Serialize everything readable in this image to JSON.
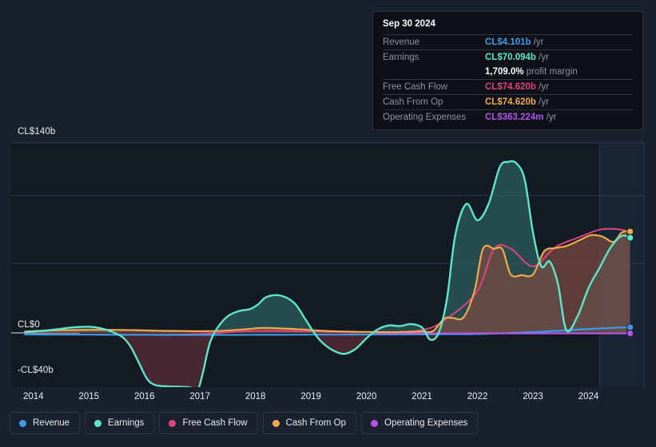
{
  "chart_data": {
    "type": "area",
    "title": "",
    "xlabel": "",
    "ylabel": "",
    "currency_prefix": "CL$",
    "ylim": [
      -40,
      140
    ],
    "yticks": [
      140,
      0,
      -40
    ],
    "ytick_labels": [
      "CL$140b",
      "CL$0",
      "-CL$40b"
    ],
    "grid": true,
    "legend_position": "bottom",
    "x_range": [
      "2013.6",
      "2025.0"
    ],
    "xticks": [
      2014,
      2015,
      2016,
      2017,
      2018,
      2019,
      2020,
      2021,
      2022,
      2023,
      2024
    ],
    "xtick_labels": [
      "2014",
      "2015",
      "2016",
      "2017",
      "2018",
      "2019",
      "2020",
      "2021",
      "2022",
      "2023",
      "2024"
    ],
    "forecast_start": "2024.2",
    "units": "CL$ billions",
    "series": [
      {
        "name": "Revenue",
        "color": "#3d9ae8",
        "x": [
          2013.85,
          2014.5,
          2015.0,
          2015.5,
          2016.0,
          2016.5,
          2017.0,
          2017.5,
          2018.0,
          2018.5,
          2019.0,
          2019.5,
          2020.0,
          2020.5,
          2021.0,
          2021.5,
          2022.0,
          2022.5,
          2023.0,
          2023.3,
          2023.6,
          2024.0,
          2024.4,
          2024.75
        ],
        "values": [
          -1.2,
          -1.3,
          -1.3,
          -1.4,
          -1.4,
          -1.5,
          -1.5,
          -1.5,
          -1.4,
          -1.4,
          -1.3,
          -1.3,
          -1.2,
          -1.2,
          -1.1,
          -1.0,
          -0.8,
          -0.2,
          0.6,
          1.2,
          1.9,
          2.8,
          3.6,
          4.101
        ]
      },
      {
        "name": "Earnings",
        "color": "#5ae8c8",
        "x": [
          2013.85,
          2014.1,
          2014.4,
          2014.7,
          2015.0,
          2015.2,
          2015.4,
          2015.6,
          2015.75,
          2015.9,
          2016.05,
          2016.2,
          2016.45,
          2016.7,
          2016.85,
          2016.95,
          2017.05,
          2017.2,
          2017.45,
          2017.7,
          2017.9,
          2018.05,
          2018.2,
          2018.45,
          2018.7,
          2018.9,
          2019.05,
          2019.2,
          2019.4,
          2019.6,
          2019.8,
          2020.0,
          2020.2,
          2020.4,
          2020.6,
          2020.8,
          2021.0,
          2021.15,
          2021.3,
          2021.45,
          2021.6,
          2021.8,
          2022.0,
          2022.2,
          2022.4,
          2022.55,
          2022.7,
          2022.85,
          2023.0,
          2023.15,
          2023.3,
          2023.45,
          2023.6,
          2023.8,
          2024.0,
          2024.2,
          2024.4,
          2024.6,
          2024.75
        ],
        "values": [
          0.5,
          1.2,
          2.5,
          4.0,
          4.5,
          3.5,
          1.0,
          -3.0,
          -10.0,
          -22.0,
          -34.0,
          -38.5,
          -39.5,
          -39.8,
          -40.5,
          -43.5,
          -30.0,
          -5.0,
          10.5,
          16.0,
          17.5,
          21.0,
          26.5,
          27.5,
          22.0,
          10.0,
          0.5,
          -7.0,
          -13.0,
          -15.5,
          -12.0,
          -4.0,
          2.5,
          5.5,
          5.0,
          6.5,
          4.0,
          -5.0,
          0.0,
          25.0,
          72.0,
          95.0,
          83.0,
          95.0,
          122.0,
          126.0,
          125.0,
          113.0,
          74.0,
          49.0,
          52.5,
          36.0,
          2.0,
          12.0,
          33.0,
          48.0,
          63.0,
          71.5,
          70.094
        ]
      },
      {
        "name": "Free Cash Flow",
        "color": "#e0447f",
        "x": [
          2013.85,
          2015.0,
          2016.0,
          2017.0,
          2018.0,
          2019.0,
          2020.0,
          2021.0,
          2021.5,
          2022.0,
          2022.3,
          2022.6,
          2023.0,
          2023.4,
          2023.8,
          2024.2,
          2024.5,
          2024.75
        ],
        "values": [
          -1.0,
          -1.2,
          -1.5,
          -0.8,
          1.5,
          1.0,
          0.5,
          2.0,
          12.0,
          31.0,
          62.0,
          62.0,
          49.0,
          63.0,
          70.0,
          76.0,
          76.5,
          74.62
        ]
      },
      {
        "name": "Cash From Op",
        "color": "#eeaa4c",
        "x": [
          2013.85,
          2014.2,
          2014.6,
          2015.0,
          2015.4,
          2015.8,
          2016.2,
          2016.6,
          2017.0,
          2017.4,
          2017.8,
          2018.1,
          2018.4,
          2018.8,
          2019.1,
          2019.4,
          2019.8,
          2020.2,
          2020.6,
          2021.0,
          2021.2,
          2021.4,
          2021.55,
          2021.75,
          2021.95,
          2022.1,
          2022.3,
          2022.45,
          2022.6,
          2022.8,
          2023.0,
          2023.2,
          2023.4,
          2023.6,
          2023.85,
          2024.05,
          2024.25,
          2024.45,
          2024.6,
          2024.75
        ],
        "values": [
          1.0,
          1.6,
          2.0,
          2.2,
          2.2,
          2.0,
          1.6,
          1.4,
          1.2,
          1.5,
          2.6,
          3.6,
          3.4,
          2.6,
          1.8,
          1.2,
          0.8,
          0.6,
          0.6,
          1.0,
          1.4,
          10.5,
          11.0,
          11.5,
          31.5,
          62.0,
          62.0,
          61.5,
          43.0,
          42.5,
          43.0,
          60.0,
          62.5,
          64.0,
          68.5,
          72.0,
          71.0,
          67.0,
          74.0,
          74.62
        ]
      },
      {
        "name": "Operating Expenses",
        "color": "#b055e8",
        "x": [
          2020.15,
          2020.5,
          2021.0,
          2021.5,
          2022.0,
          2022.5,
          2023.0,
          2023.5,
          2024.0,
          2024.4,
          2024.75
        ],
        "values": [
          -0.35,
          -0.35,
          -0.35,
          -0.35,
          -0.35,
          -0.35,
          -0.36,
          -0.36,
          -0.36,
          -0.363,
          -0.363224
        ]
      }
    ]
  },
  "tooltip": {
    "date": "Sep 30 2024",
    "rows": [
      {
        "label": "Revenue",
        "value": "CL$4.101b",
        "suffix": "/yr",
        "color": "#3d9ae8"
      },
      {
        "label": "Earnings",
        "value": "CL$70.094b",
        "suffix": "/yr",
        "color": "#5ae8c8"
      },
      {
        "label": "Free Cash Flow",
        "value": "CL$74.620b",
        "suffix": "/yr",
        "color": "#e0447f"
      },
      {
        "label": "Cash From Op",
        "value": "CL$74.620b",
        "suffix": "/yr",
        "color": "#eeaa4c"
      },
      {
        "label": "Operating Expenses",
        "value": "CL$363.224m",
        "suffix": "/yr",
        "color": "#b055e8"
      }
    ],
    "profit_margin": {
      "value": "1,709.0%",
      "label": "profit margin"
    }
  },
  "legend": {
    "items": [
      {
        "label": "Revenue",
        "color": "#3d9ae8"
      },
      {
        "label": "Earnings",
        "color": "#5ae8c8"
      },
      {
        "label": "Free Cash Flow",
        "color": "#e0447f"
      },
      {
        "label": "Cash From Op",
        "color": "#eeaa4c"
      },
      {
        "label": "Operating Expenses",
        "color": "#b055e8"
      }
    ]
  },
  "theme": {
    "background": "#1a202c",
    "plot_background": "#131a24",
    "grid_color": "#313a47",
    "text_color": "#e8edf2",
    "muted_text": "#8b949e"
  }
}
